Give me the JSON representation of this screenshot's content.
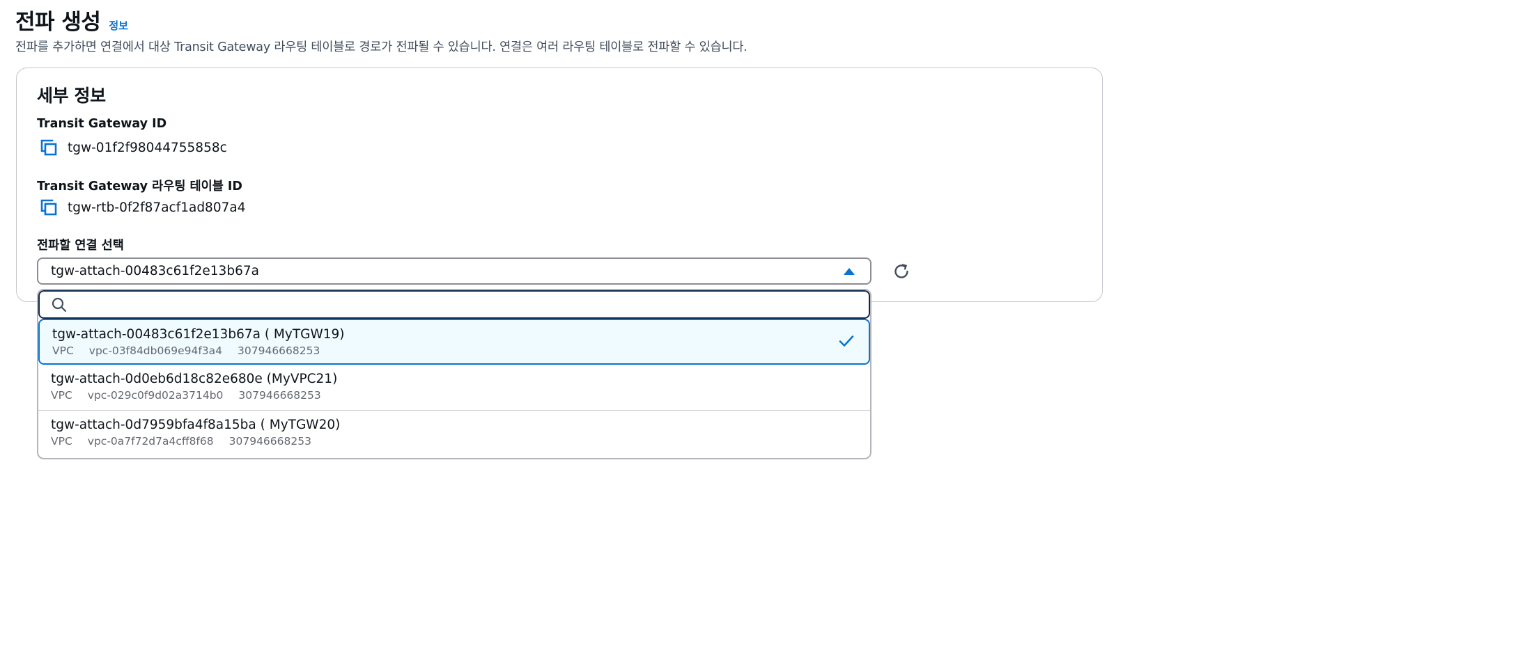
{
  "header": {
    "title": "전파 생성",
    "info_link": "정보",
    "description": "전파를 추가하면 연결에서 대상 Transit Gateway 라우팅 테이블로 경로가 전파될 수 있습니다. 연결은 여러 라우팅 테이블로 전파할 수 있습니다."
  },
  "details": {
    "title": "세부 정보",
    "tgw_label": "Transit Gateway ID",
    "tgw_value": "tgw-01f2f98044755858c",
    "rtb_label": "Transit Gateway 라우팅 테이블 ID",
    "rtb_value": "tgw-rtb-0f2f87acf1ad807a4",
    "select_label": "전파할 연결 선택",
    "selected_value": "tgw-attach-00483c61f2e13b67a",
    "search_placeholder": ""
  },
  "options": [
    {
      "title": "tgw-attach-00483c61f2e13b67a ( MyTGW19)",
      "type": "VPC",
      "vpc": "vpc-03f84db069e94f3a4",
      "account": "307946668253",
      "selected": true
    },
    {
      "title": "tgw-attach-0d0eb6d18c82e680e (MyVPC21)",
      "type": "VPC",
      "vpc": "vpc-029c0f9d02a3714b0",
      "account": "307946668253",
      "selected": false
    },
    {
      "title": "tgw-attach-0d7959bfa4f8a15ba ( MyTGW20)",
      "type": "VPC",
      "vpc": "vpc-0a7f72d7a4cff8f68",
      "account": "307946668253",
      "selected": false
    }
  ],
  "icons": {
    "copy": "copy-icon",
    "caret": "caret-up-icon",
    "refresh": "refresh-icon",
    "search": "search-icon",
    "check": "check-icon"
  },
  "colors": {
    "accent": "#0972d3",
    "selected_bg": "#f0fbff",
    "text": "#0f141a",
    "muted": "#656871"
  }
}
